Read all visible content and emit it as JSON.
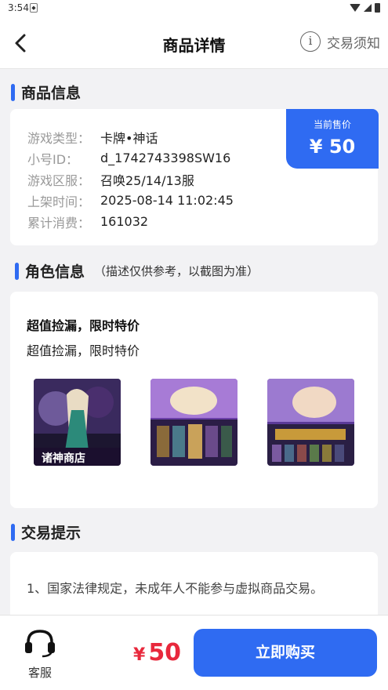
{
  "status_bar": {
    "time": "3:54",
    "notif_icon": "shield-notification-icon"
  },
  "header": {
    "title": "商品详情",
    "notice_icon_text": "i",
    "notice_label": "交易须知"
  },
  "product_info": {
    "section_title": "商品信息",
    "rows": [
      {
        "key": "游戏类型：",
        "value": "卡牌•神话"
      },
      {
        "key": "小号ID：",
        "value": "d_1742743398SW16"
      },
      {
        "key": "游戏区服：",
        "value": "召唤25/14/13服"
      },
      {
        "key": "上架时间：",
        "value": "2025-08-14 11:02:45"
      },
      {
        "key": "累计消费：",
        "value": "161032"
      }
    ],
    "price_label": "当前售价",
    "price_value": "¥ 50"
  },
  "role_info": {
    "section_title": "角色信息",
    "section_subtitle": "（描述仅供参考，以截图为准）",
    "title": "超值捡漏，限时特价",
    "description": "超值捡漏，限时特价"
  },
  "trade_tips": {
    "section_title": "交易提示",
    "text": "1、国家法律规定，未成年人不能参与虚拟商品交易。"
  },
  "bottom_bar": {
    "service_label": "客服",
    "currency": "¥",
    "price": "50",
    "buy_label": "立即购买"
  },
  "colors": {
    "accent": "#2f6bf2",
    "price_red": "#e8283c",
    "background": "#f2f2f4"
  }
}
